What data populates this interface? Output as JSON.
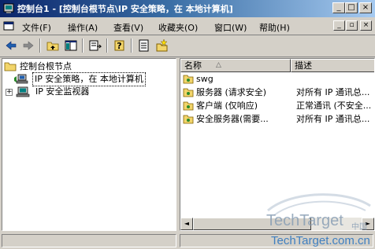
{
  "window": {
    "title": "控制台1 - [控制台根节点\\IP 安全策略，在 本地计算机]",
    "minimize_glyph": "_",
    "maximize_glyph": "□",
    "close_glyph": "×"
  },
  "menu": {
    "items": [
      "文件(F)",
      "操作(A)",
      "查看(V)",
      "收藏夹(O)",
      "窗口(W)",
      "帮助(H)"
    ],
    "mdi_min": "_",
    "mdi_restore": "▫",
    "mdi_close": "×"
  },
  "toolbar": {
    "icons": [
      "back-arrow-icon",
      "forward-arrow-icon",
      "up-folder-icon",
      "show-hide-tree-icon",
      "export-list-icon",
      "help-icon",
      "properties-icon",
      "add-policy-icon"
    ]
  },
  "tree": {
    "root": "控制台根节点",
    "items": [
      "IP 安全策略，在 本地计算机",
      "IP 安全监视器"
    ],
    "expander": "+"
  },
  "list": {
    "columns": [
      "名称",
      "描述"
    ],
    "sort_indicator": "△",
    "rows": [
      {
        "name": "swg",
        "desc": ""
      },
      {
        "name": "服务器 (请求安全)",
        "desc": "对所有 IP 通讯总..."
      },
      {
        "name": "客户端 (仅响应)",
        "desc": "正常通讯 (不安全..."
      },
      {
        "name": "安全服务器(需要...",
        "desc": "对所有 IP 通讯总..."
      }
    ]
  },
  "scrollbar": {
    "left_arrow": "◄",
    "right_arrow": "►"
  },
  "watermark": {
    "brand": "TechTarget",
    "cn": "中国",
    "url": "TechTarget.com.cn"
  },
  "colors": {
    "titlebar_start": "#0a246a",
    "titlebar_end": "#a6caf0",
    "face": "#d4d0c8",
    "watermark_url": "#3f7fc0"
  }
}
